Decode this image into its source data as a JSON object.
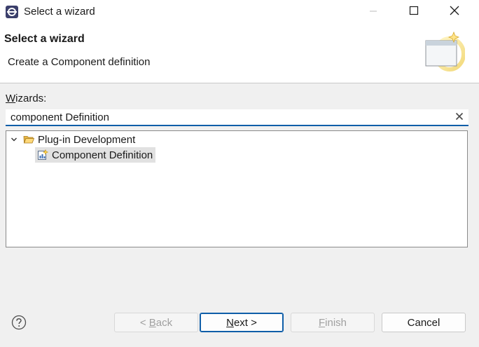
{
  "window": {
    "title": "Select a wizard",
    "icons": {
      "app": "eclipse-icon",
      "minimize": "minimize-icon",
      "maximize": "maximize-icon",
      "close": "close-icon"
    }
  },
  "header": {
    "title": "Select a wizard",
    "description": "Create a Component definition",
    "graphic": "new-wizard-banner-icon"
  },
  "wizards": {
    "label_mnemonic": "W",
    "label_rest": "izards:",
    "filter_value": "component Definition",
    "clear_icon": "clear-icon"
  },
  "tree": {
    "nodes": [
      {
        "label": "Plug-in Development",
        "expanded": true,
        "icon": "open-folder-icon",
        "children": [
          {
            "label": "Component Definition",
            "selected": true,
            "icon": "component-definition-icon"
          }
        ]
      }
    ]
  },
  "buttons": {
    "help_icon": "help-icon",
    "back": {
      "prefix": "< ",
      "mnemonic": "B",
      "rest": "ack",
      "enabled": false
    },
    "next": {
      "mnemonic": "N",
      "rest": "ext >",
      "enabled": true,
      "default": true
    },
    "finish": {
      "mnemonic": "F",
      "rest": "inish",
      "enabled": false
    },
    "cancel": {
      "label": "Cancel",
      "enabled": true
    }
  },
  "colors": {
    "accent": "#0f5ea8",
    "selection": "#e1e1e1",
    "dialog_bg": "#f0f0f0"
  }
}
